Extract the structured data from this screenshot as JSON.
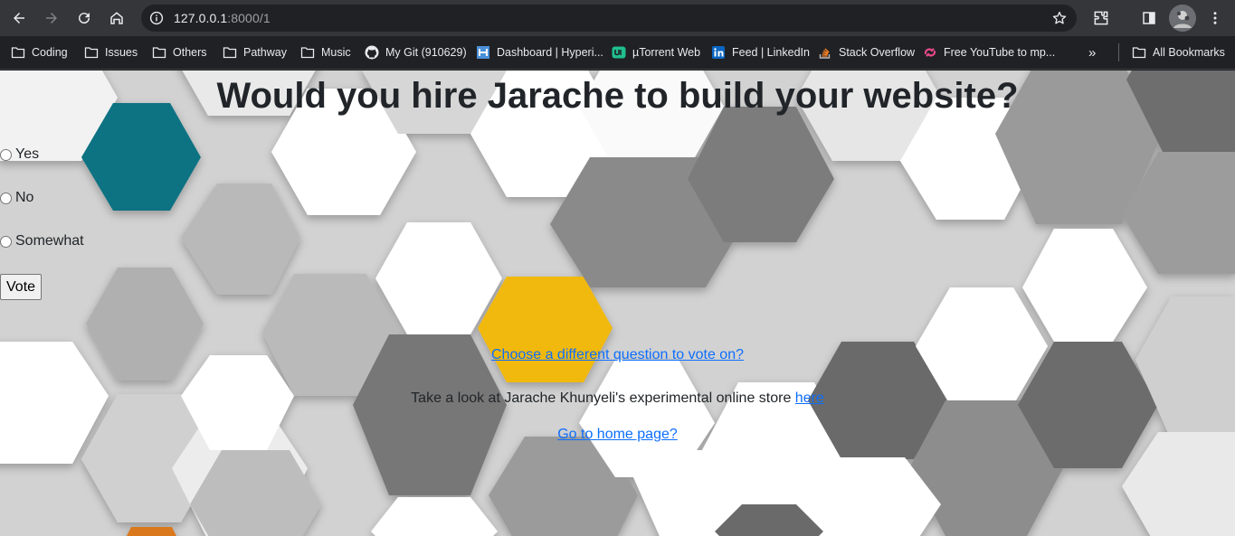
{
  "browser": {
    "url_host": "127.0.0.1",
    "url_rest": ":8000/1",
    "icons": [
      "back-arrow-icon",
      "forward-arrow-icon",
      "reload-icon",
      "home-icon",
      "site-info-icon",
      "bookmark-star-icon",
      "extensions-icon",
      "side-panel-icon",
      "profile-avatar",
      "kebab-menu-icon"
    ]
  },
  "bookmarks": {
    "items": [
      {
        "label": "Coding",
        "icon": "folder-icon"
      },
      {
        "label": "Issues",
        "icon": "folder-icon"
      },
      {
        "label": "Others",
        "icon": "folder-icon"
      },
      {
        "label": "Pathway",
        "icon": "folder-icon"
      },
      {
        "label": "Music",
        "icon": "folder-icon"
      },
      {
        "label": "My Git (910629)",
        "icon": "github-icon"
      },
      {
        "label": "Dashboard | Hyperi...",
        "icon": "hyperiondev-icon"
      },
      {
        "label": "µTorrent Web",
        "icon": "utorrent-icon"
      },
      {
        "label": "Feed | LinkedIn",
        "icon": "linkedin-icon"
      },
      {
        "label": "Stack Overflow",
        "icon": "stackoverflow-icon"
      },
      {
        "label": "Free YouTube to mp...",
        "icon": "youtube-converter-icon"
      }
    ],
    "overflow": "»",
    "all_bookmarks": "All Bookmarks"
  },
  "poll": {
    "question": "Would you hire Jarache to build your website?",
    "choices": [
      "Yes",
      "No",
      "Somewhat"
    ],
    "selected": null,
    "vote_label": "Vote"
  },
  "links": {
    "different_question": "Choose a different question to vote on?",
    "store_text": "Take a look at Jarache Khunyeli's experimental online store ",
    "store_link": "here",
    "home": "Go to home page?"
  },
  "colors": {
    "link": "#0d6efd",
    "hex_teal": "#0e7282",
    "hex_yellow": "#f1b90c",
    "hex_orange": "#d9781f"
  }
}
